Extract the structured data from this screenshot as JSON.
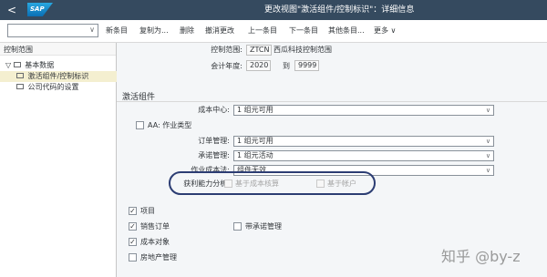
{
  "titlebar": {
    "back": "<",
    "logo": "SAP",
    "title": "更改视图\"激活组件/控制标识\"：详细信息"
  },
  "toolbar": {
    "command_value": "",
    "new_entry": "新条目",
    "copy_as": "复制为...",
    "delete": "删除",
    "undo": "撤消更改",
    "previous": "上一条目",
    "next": "下一条目",
    "other": "其他条目...",
    "more": "更多 ∨"
  },
  "tree": {
    "header": "控制范围",
    "items": [
      {
        "label": "基本数据",
        "expander": "▽"
      },
      {
        "label": "激活组件/控制标识"
      },
      {
        "label": "公司代码的设置"
      }
    ]
  },
  "header_fields": {
    "controlling_area_label": "控制范围:",
    "controlling_area_value": "ZTCN",
    "controlling_area_text": "西瓜科技控制范围",
    "fiscal_year_label": "会计年度:",
    "fiscal_year_from": "2020",
    "fiscal_year_to_label": "到",
    "fiscal_year_to": "9999"
  },
  "section_title": "激活组件",
  "components": {
    "cost_center_label": "成本中心:",
    "cost_center_value": "1 组元可用",
    "aa_label": "AA: 作业类型",
    "order_mgmt_label": "订单管理:",
    "order_mgmt_value": "1 组元可用",
    "commitment_label": "承诺管理:",
    "commitment_value": "1 组元活动",
    "abc_label": "作业成本法:",
    "abc_value": "组件无效",
    "profitability_label": "获利能力分析:",
    "costing_based": "基于成本核算",
    "account_based": "基于帐户"
  },
  "checkboxes": [
    {
      "label": "项目",
      "checked": true
    },
    {
      "label": "销售订单",
      "checked": true
    },
    {
      "label": "成本对象",
      "checked": true
    },
    {
      "label": "房地产管理",
      "checked": false
    }
  ],
  "commitment_mgmt_cb": {
    "label": "带承诺管理",
    "checked": false
  },
  "check_glyph": "✓",
  "dropdown_glyph": "∨",
  "watermark": "知乎 @by-z",
  "colors": {
    "titlebar": "#354a5f",
    "selected_row": "#f4efd0",
    "highlight_oval": "#2c3d73"
  }
}
